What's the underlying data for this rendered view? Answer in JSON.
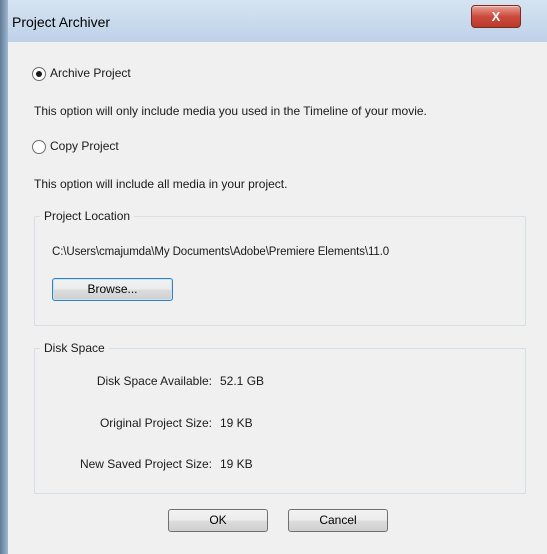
{
  "window": {
    "title": "Project Archiver",
    "close_label": "X"
  },
  "options": {
    "archive": {
      "label": "Archive Project",
      "selected": true,
      "description": "This option will only include media you used in the Timeline of your movie."
    },
    "copy": {
      "label": "Copy Project",
      "selected": false,
      "description": "This option will include all media in your project."
    }
  },
  "location": {
    "group_title": "Project Location",
    "path": "C:\\Users\\cmajumda\\My Documents\\Adobe\\Premiere Elements\\11.0",
    "browse_label": "Browse..."
  },
  "disk": {
    "group_title": "Disk Space",
    "rows": [
      {
        "label": "Disk Space Available:",
        "value": "52.1 GB"
      },
      {
        "label": "Original Project Size:",
        "value": "19 KB"
      },
      {
        "label": "New Saved Project Size:",
        "value": "19 KB"
      }
    ]
  },
  "buttons": {
    "ok": "OK",
    "cancel": "Cancel"
  }
}
